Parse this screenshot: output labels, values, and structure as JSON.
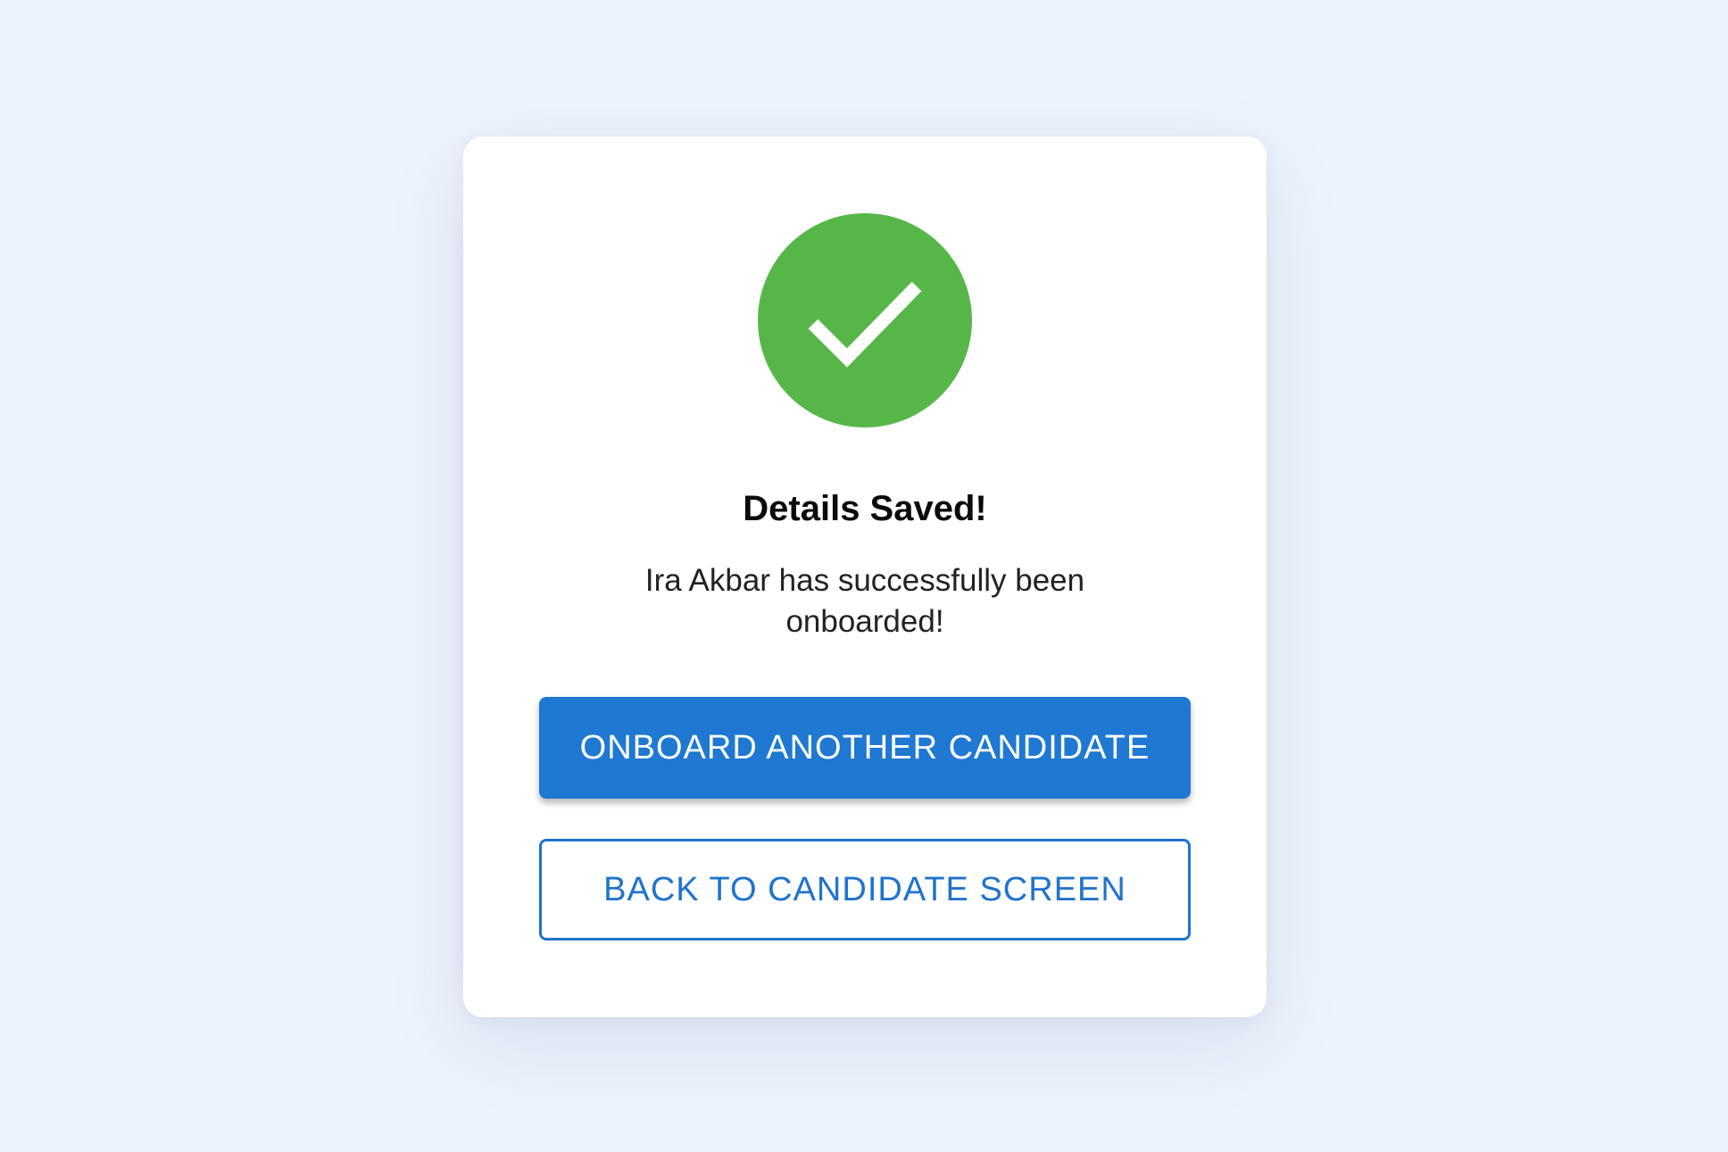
{
  "dialog": {
    "icon": "check-circle-icon",
    "title": "Details Saved!",
    "message": "Ira Akbar has successfully been onboarded!",
    "primary_button_label": "ONBOARD ANOTHER CANDIDATE",
    "secondary_button_label": "BACK TO CANDIDATE SCREEN"
  },
  "colors": {
    "background": "#edf3fc",
    "success": "#56b748",
    "primary": "#1f78d2"
  }
}
